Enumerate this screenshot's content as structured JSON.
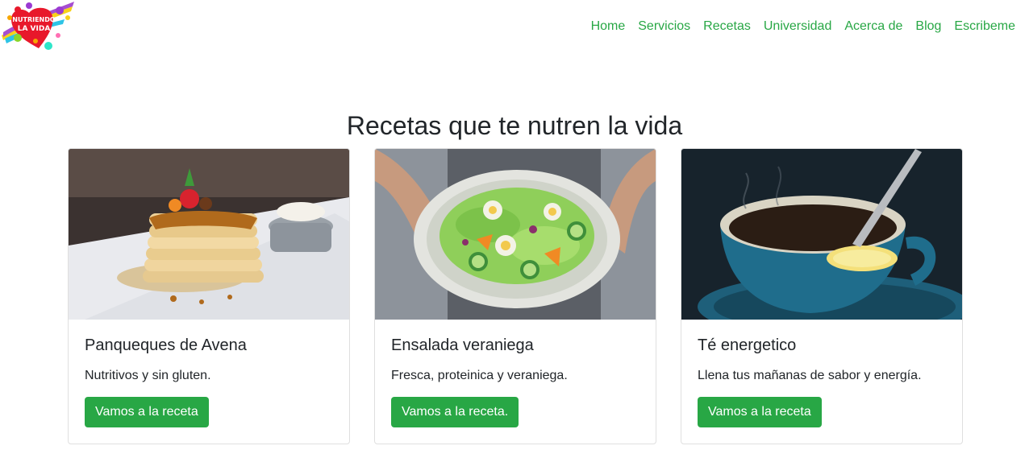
{
  "nav": {
    "items": [
      "Home",
      "Servicios",
      "Recetas",
      "Universidad",
      "Acerca de",
      "Blog",
      "Escribeme"
    ],
    "color": "#28a745"
  },
  "logo": {
    "text_line1": "NUTRIENDO",
    "text_line2": "LA VIDA"
  },
  "heading": "Recetas que te nutren la vida",
  "cards": [
    {
      "title": "Panqueques de Avena",
      "text": "Nutritivos y sin gluten.",
      "button": "Vamos a la receta",
      "image": "pancakes-photo"
    },
    {
      "title": "Ensalada veraniega",
      "text": "Fresca, proteinica y veraniega.",
      "button": "Vamos a la receta.",
      "image": "salad-photo"
    },
    {
      "title": "Té energetico",
      "text": "Llena tus mañanas de sabor y energía.",
      "button": "Vamos a la receta",
      "image": "tea-photo"
    }
  ],
  "accent": "#28a745"
}
